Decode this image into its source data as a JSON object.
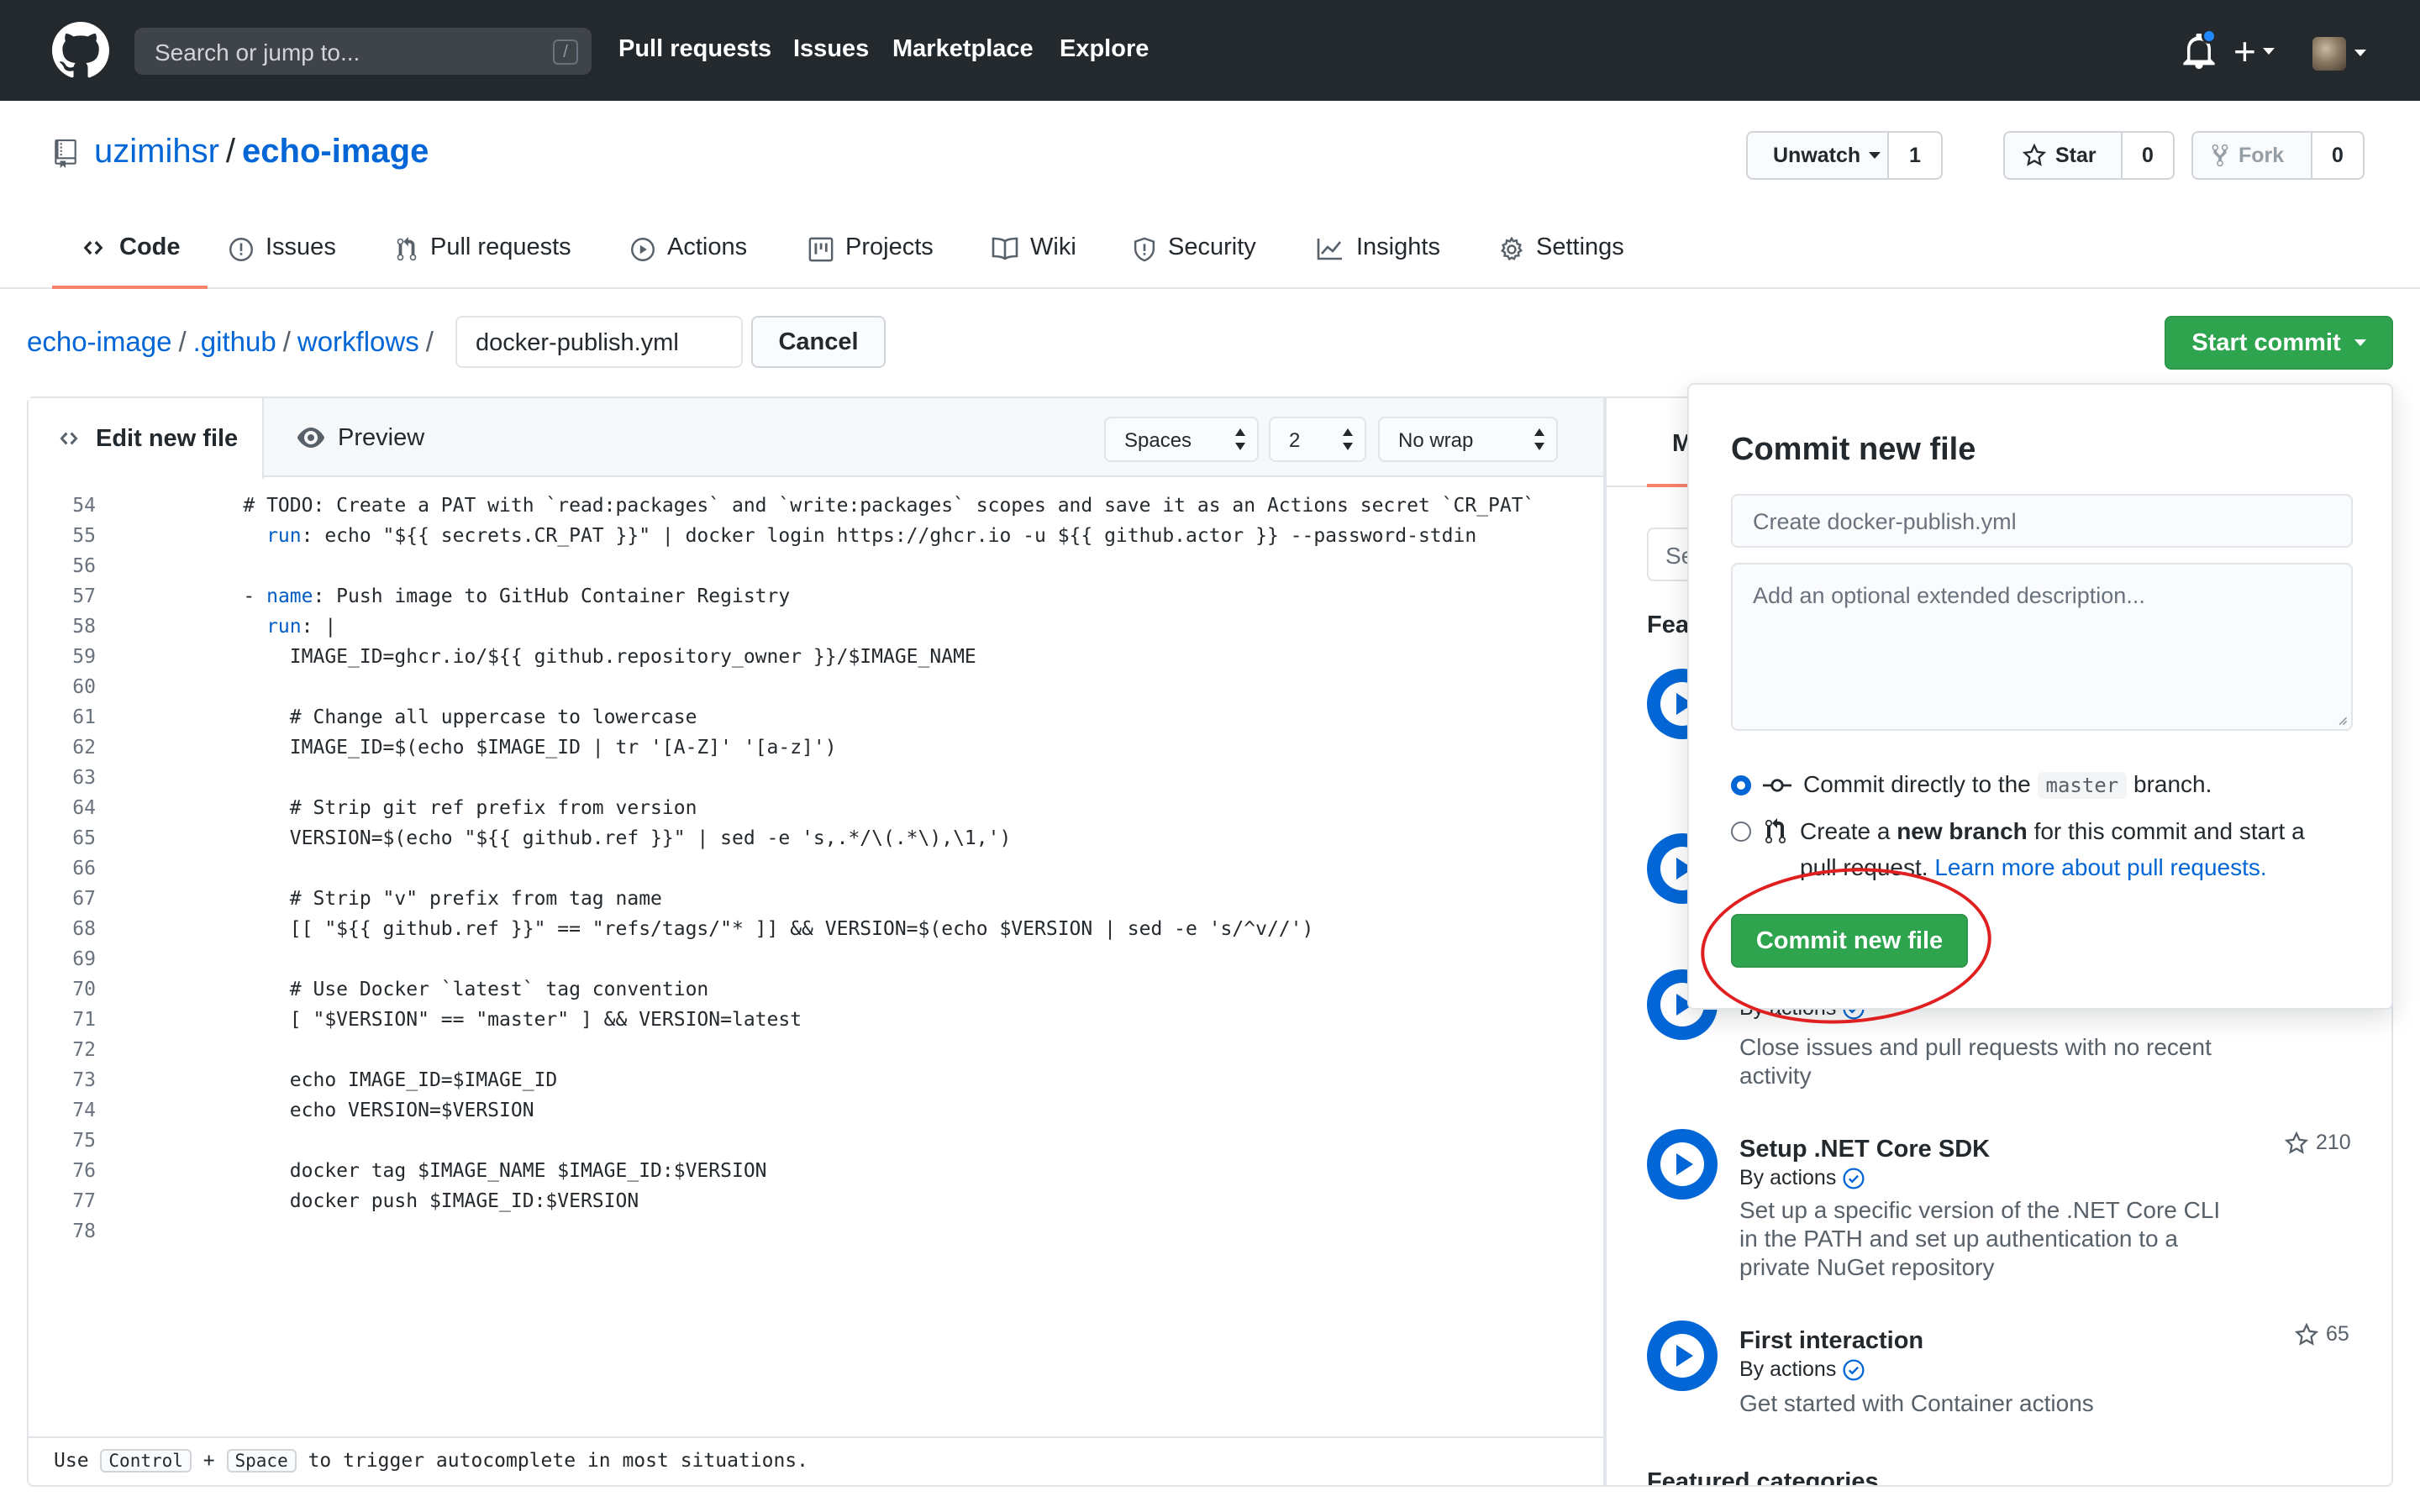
{
  "header": {
    "search_placeholder": "Search or jump to...",
    "search_key": "/",
    "nav": [
      "Pull requests",
      "Issues",
      "Marketplace",
      "Explore"
    ],
    "plus": "+"
  },
  "repo": {
    "owner": "uzimihsr",
    "separator": "/",
    "name": "echo-image",
    "watch_label": "Unwatch",
    "watch_count": "1",
    "star_label": "Star",
    "star_count": "0",
    "fork_label": "Fork",
    "fork_count": "0"
  },
  "tabs": [
    "Code",
    "Issues",
    "Pull requests",
    "Actions",
    "Projects",
    "Wiki",
    "Security",
    "Insights",
    "Settings"
  ],
  "breadcrumb": {
    "parts": [
      "echo-image",
      ".github",
      "workflows"
    ],
    "sep": "/",
    "filename": "docker-publish.yml",
    "cancel": "Cancel",
    "start_commit": "Start commit"
  },
  "editor": {
    "tab_edit": "Edit new file",
    "tab_preview": "Preview",
    "indent_mode": "Spaces",
    "indent_size": "2",
    "wrap_mode": "No wrap",
    "lines": [
      {
        "n": "54",
        "t": "    # TODO: Create a PAT with `read:packages` and `write:packages` scopes and save it as an Actions secret `CR_PAT`"
      },
      {
        "n": "55",
        "k": "      run",
        "t": ": echo \"${{ secrets.CR_PAT }}\" | docker login https://ghcr.io -u ${{ github.actor }} --password-stdin"
      },
      {
        "n": "56",
        "t": ""
      },
      {
        "n": "57",
        "p": "    - ",
        "k": "name",
        "t": ": Push image to GitHub Container Registry"
      },
      {
        "n": "58",
        "k": "      run",
        "t": ": |"
      },
      {
        "n": "59",
        "t": "        IMAGE_ID=ghcr.io/${{ github.repository_owner }}/$IMAGE_NAME"
      },
      {
        "n": "60",
        "t": ""
      },
      {
        "n": "61",
        "t": "        # Change all uppercase to lowercase"
      },
      {
        "n": "62",
        "t": "        IMAGE_ID=$(echo $IMAGE_ID | tr '[A-Z]' '[a-z]')"
      },
      {
        "n": "63",
        "t": ""
      },
      {
        "n": "64",
        "t": "        # Strip git ref prefix from version"
      },
      {
        "n": "65",
        "t": "        VERSION=$(echo \"${{ github.ref }}\" | sed -e 's,.*/\\(.*\\),\\1,')"
      },
      {
        "n": "66",
        "t": ""
      },
      {
        "n": "67",
        "t": "        # Strip \"v\" prefix from tag name"
      },
      {
        "n": "68",
        "t": "        [[ \"${{ github.ref }}\" == \"refs/tags/\"* ]] && VERSION=$(echo $VERSION | sed -e 's/^v//')"
      },
      {
        "n": "69",
        "t": ""
      },
      {
        "n": "70",
        "t": "        # Use Docker `latest` tag convention"
      },
      {
        "n": "71",
        "t": "        [ \"$VERSION\" == \"master\" ] && VERSION=latest"
      },
      {
        "n": "72",
        "t": ""
      },
      {
        "n": "73",
        "t": "        echo IMAGE_ID=$IMAGE_ID"
      },
      {
        "n": "74",
        "t": "        echo VERSION=$VERSION"
      },
      {
        "n": "75",
        "t": ""
      },
      {
        "n": "76",
        "t": "        docker tag $IMAGE_NAME $IMAGE_ID:$VERSION"
      },
      {
        "n": "77",
        "t": "        docker push $IMAGE_ID:$VERSION"
      },
      {
        "n": "78",
        "t": ""
      }
    ],
    "footer": {
      "use": "Use",
      "key1": "Control",
      "plus": "+",
      "key2": "Space",
      "rest": "to trigger autocomplete in most situations."
    }
  },
  "marketplace": {
    "tab_partial": "M",
    "search_partial": "Se",
    "featured_partial": "Feat",
    "by_partial": "By actions",
    "actions": [
      {
        "title": "",
        "by": "",
        "desc": "Close issues and pull requests with no recent activity",
        "stars": ""
      },
      {
        "title": "Setup .NET Core SDK",
        "by": "By actions",
        "desc": "Set up a specific version of the .NET Core CLI in the PATH and set up authentication to a private NuGet repository",
        "stars": "210"
      },
      {
        "title": "First interaction",
        "by": "By actions",
        "desc": "Get started with Container actions",
        "stars": "65"
      }
    ],
    "featured_categories": "Featured categories"
  },
  "commit_popover": {
    "title": "Commit new file",
    "summary_placeholder": "Create docker-publish.yml",
    "description_placeholder": "Add an optional extended description...",
    "option_direct_prefix": "Commit directly to the",
    "branch": "master",
    "option_direct_suffix": "branch.",
    "option_new_prefix": "Create a",
    "option_new_bold": "new branch",
    "option_new_suffix": "for this commit and start a",
    "option_new_line2": "pull request.",
    "learn_more": "Learn more about pull requests.",
    "commit_button": "Commit new file",
    "selected_option": "direct"
  },
  "colors": {
    "header_bg": "#24292e",
    "link": "#0366d6",
    "primary_button": "#2ea44f",
    "tab_underline": "#f9826c",
    "annotation_circle": "#e02020"
  }
}
